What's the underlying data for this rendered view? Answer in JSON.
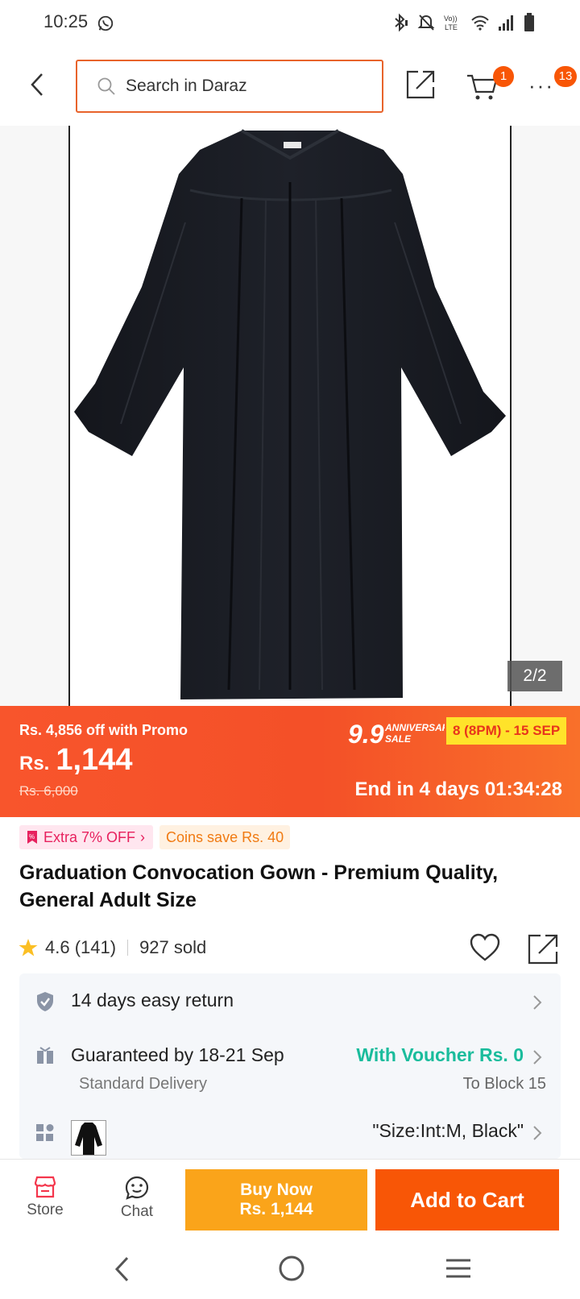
{
  "status_bar": {
    "time": "10:25",
    "icons": [
      "whatsapp-icon",
      "bluetooth-icon",
      "mute-icon",
      "volte-icon",
      "wifi-icon",
      "signal-icon",
      "battery-icon"
    ],
    "volte_label": "Vo)) LTE"
  },
  "header": {
    "search_placeholder": "Search in Daraz",
    "cart_count": "1",
    "more_count": "13"
  },
  "gallery": {
    "counter": "2/2"
  },
  "price": {
    "promo": "Rs. 4,856 off with Promo",
    "currency": "Rs.",
    "value": "1,144",
    "original": "Rs. 6,000",
    "sale_logo": "9.9",
    "sale_logo_sub1": "ANNIVERSARY",
    "sale_logo_sub2": "SALE",
    "sale_date": "8 (8PM) - 15 SEP",
    "countdown": "End in 4 days 01:34:28"
  },
  "chips": {
    "extra": "Extra 7% OFF",
    "coins": "Coins save Rs. 40"
  },
  "product": {
    "title": "Graduation Convocation Gown - Premium Quality, General Adult Size",
    "rating": "4.6 (141)",
    "sold": "927 sold"
  },
  "info": {
    "return": "14 days easy return",
    "delivery": "Guaranteed by 18-21 Sep",
    "voucher": "With Voucher Rs. 0",
    "delivery_type": "Standard Delivery",
    "location": "To Block 15",
    "variant": "\"Size:Int:M, Black\""
  },
  "action_bar": {
    "store": "Store",
    "chat": "Chat",
    "buy_now": "Buy Now",
    "buy_now_price": "Rs. 1,144",
    "add_to_cart": "Add to Cart"
  },
  "colors": {
    "brand": "#f85606",
    "buy_now": "#faa41a",
    "voucher": "#1abc9c",
    "search_border": "#e8632b"
  }
}
